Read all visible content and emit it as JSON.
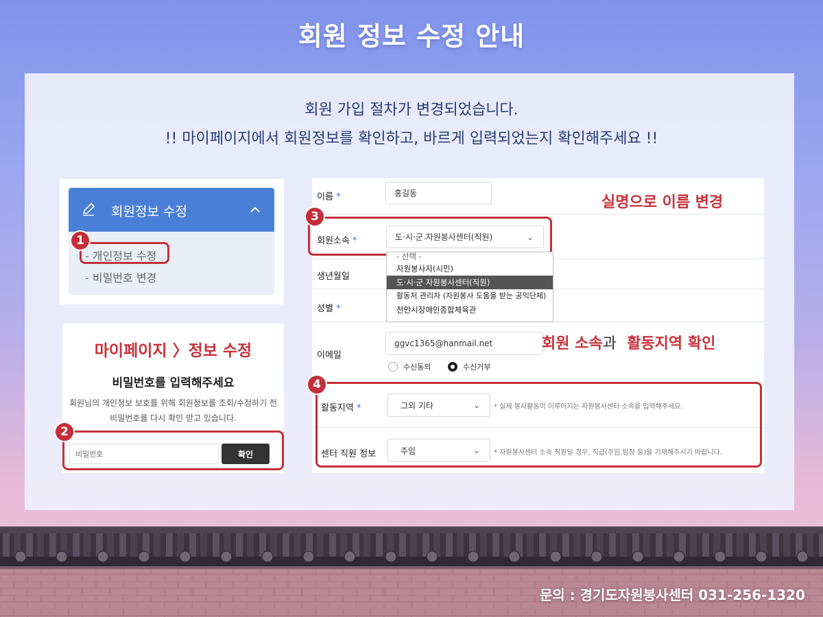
{
  "title": "회원 정보 수정 안내",
  "notice_line1": "회원 가입 절차가 변경되었습니다.",
  "notice_line2": "!! 마이페이지에서 회원정보를 확인하고, 바르게 입력되었는지 확인해주세요 !!",
  "sidebar": {
    "header_label": "회원정보 수정",
    "items": [
      "- 개인정보 수정",
      "- 비밀번호 변경"
    ]
  },
  "password_card": {
    "path_label": "마이페이지 〉정보 수정",
    "heading": "비밀번호를 입력해주세요",
    "desc_line1": "회원님의 개인정보 보호를 위해 회원정보를 조회/수정하기 전",
    "desc_line2": "비밀번호를 다시 확인 받고 있습니다.",
    "input_placeholder": "비밀번호",
    "confirm_label": "확인"
  },
  "steps": [
    "1",
    "2",
    "3",
    "4"
  ],
  "annotations": {
    "name_change": "실명으로 이름 변경",
    "affiliation_prefix": "회원 소속",
    "affiliation_connector": "과",
    "affiliation_suffix": "활동지역 확인"
  },
  "form": {
    "name_label": "이름",
    "name_value": "홍길동",
    "affiliation_label": "회원소속",
    "affiliation_value": "도·시·군 자원봉사센터(직원)",
    "affiliation_options": [
      "- 선택 -",
      "자원봉사자(시민)",
      "도·시·군 자원봉사센터(직원)",
      "활동처 관리자 (자원봉사 도움을 받는 공익단체)",
      "천안시장애인종합체육관"
    ],
    "selected_option_index": 2,
    "birth_label": "생년월일",
    "gender_label": "성별",
    "email_label": "이메일",
    "email_value": "ggvc1365@hanmail.net",
    "radio_agree": "수신동의",
    "radio_reject": "수신거부",
    "radio_selected": "수신거부",
    "region_label": "활동지역",
    "region_value": "그외 기타",
    "region_hint": "* 실제 봉사활동이 이루어지는 자원봉사센터 소속을 입력해주세요.",
    "staff_label": "센터 직원 정보",
    "staff_value": "주임",
    "staff_hint": "* 자원봉사센터 소속 직원일 경우, 직급(주임,팀장 등)을 기재해주시기 바랍니다.",
    "required_mark": "*"
  },
  "footer_contact": "문의 : 경기도자원봉사센터 031-256-1320",
  "colors": {
    "accent_red": "#c32f39",
    "menu_blue": "#4a7fd8",
    "notice_navy": "#283a77"
  }
}
